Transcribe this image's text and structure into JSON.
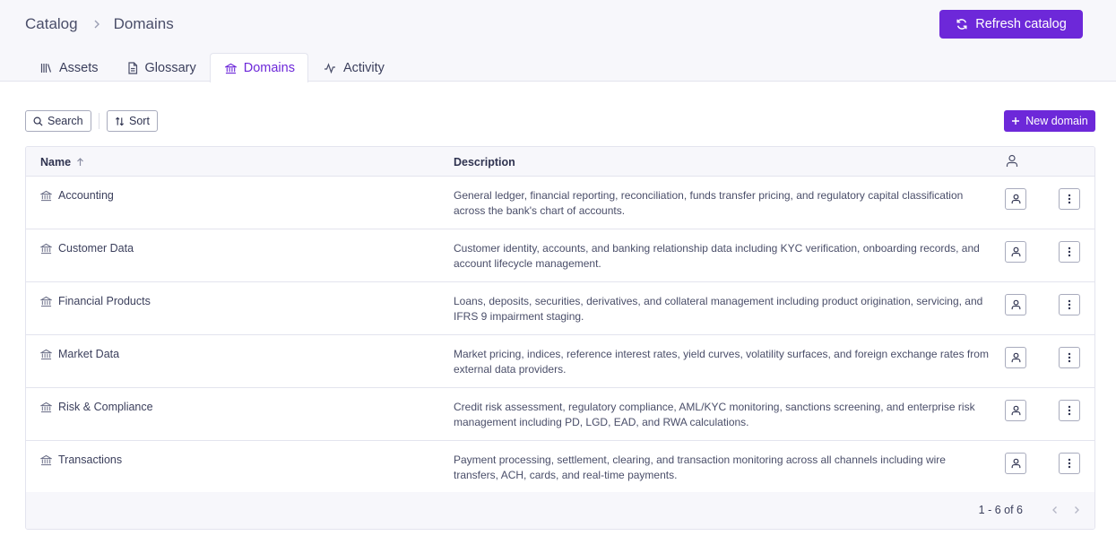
{
  "breadcrumb": {
    "root": "Catalog",
    "current": "Domains"
  },
  "header": {
    "refresh_label": "Refresh catalog"
  },
  "tabs": [
    {
      "label": "Assets",
      "icon": "library-icon"
    },
    {
      "label": "Glossary",
      "icon": "document-icon"
    },
    {
      "label": "Domains",
      "icon": "bank-icon",
      "active": true
    },
    {
      "label": "Activity",
      "icon": "activity-icon"
    }
  ],
  "toolbar": {
    "search_label": "Search",
    "sort_label": "Sort",
    "new_label": "New domain"
  },
  "table": {
    "columns": {
      "name": "Name",
      "description": "Description"
    },
    "rows": [
      {
        "name": "Accounting",
        "description": "General ledger, financial reporting, reconciliation, funds transfer pricing, and regulatory capital classification across the bank's chart of accounts."
      },
      {
        "name": "Customer Data",
        "description": "Customer identity, accounts, and banking relationship data including KYC verification, onboarding records, and account lifecycle management."
      },
      {
        "name": "Financial Products",
        "description": "Loans, deposits, securities, derivatives, and collateral management including product origination, servicing, and IFRS 9 impairment staging."
      },
      {
        "name": "Market Data",
        "description": "Market pricing, indices, reference interest rates, yield curves, volatility surfaces, and foreign exchange rates from external data providers."
      },
      {
        "name": "Risk & Compliance",
        "description": "Credit risk assessment, regulatory compliance, AML/KYC monitoring, sanctions screening, and enterprise risk management including PD, LGD, EAD, and RWA calculations."
      },
      {
        "name": "Transactions",
        "description": "Payment processing, settlement, clearing, and transaction monitoring across all channels including wire transfers, ACH, cards, and real-time payments."
      }
    ]
  },
  "pagination": {
    "label": "1 - 6 of 6"
  },
  "colors": {
    "accent": "#6d28d9",
    "border": "#e3e4ee",
    "header_bg": "#f7f7fb"
  }
}
